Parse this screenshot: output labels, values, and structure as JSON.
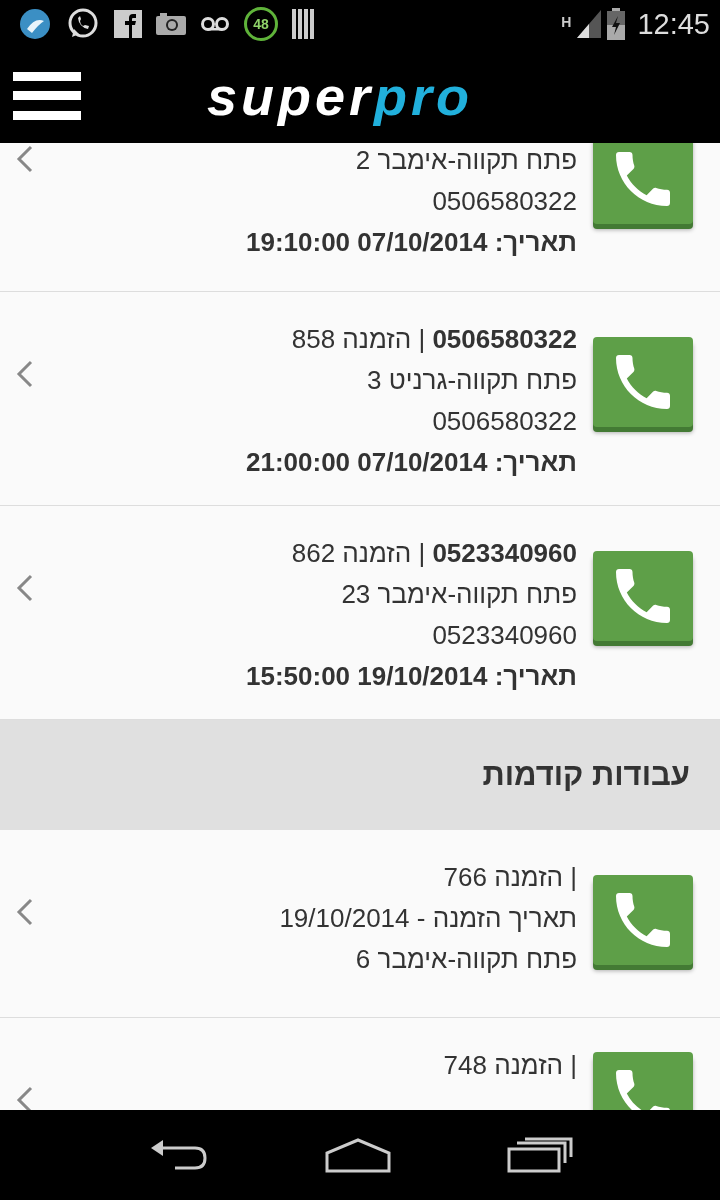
{
  "status_bar": {
    "time": "12:45",
    "network": "H",
    "badge": "48"
  },
  "header": {
    "logo_first": "super",
    "logo_second": "pro"
  },
  "list": [
    {
      "kind": "job",
      "lines": [
        {
          "text": "פתח תקווה-אימבר 2",
          "bold": false
        },
        {
          "text": "0506580322",
          "bold": false
        },
        {
          "text": "תאריך: 07/10/2014 19:10:00",
          "bold": true
        }
      ]
    },
    {
      "kind": "job",
      "lines": [
        {
          "text": "**0506580322** | הזמנה 858",
          "bold": false
        },
        {
          "text": "פתח תקווה-גרניט 3",
          "bold": false
        },
        {
          "text": "0506580322",
          "bold": false
        },
        {
          "text": "תאריך: 07/10/2014 21:00:00",
          "bold": true
        }
      ]
    },
    {
      "kind": "job",
      "lines": [
        {
          "text": "**0523340960** | הזמנה 862",
          "bold": false
        },
        {
          "text": "פתח תקווה-אימבר 23",
          "bold": false
        },
        {
          "text": "0523340960",
          "bold": false
        },
        {
          "text": "תאריך: 19/10/2014 15:50:00",
          "bold": true
        }
      ]
    },
    {
      "kind": "header",
      "title": "עבודות קודמות"
    },
    {
      "kind": "job",
      "lines": [
        {
          "text": "| הזמנה 766",
          "bold": false
        },
        {
          "text": "תאריך הזמנה - 19/10/2014",
          "bold": false
        },
        {
          "text": "פתח תקווה-אימבר 6",
          "bold": false
        }
      ]
    },
    {
      "kind": "job",
      "lines": [
        {
          "text": "| הזמנה 748",
          "bold": false
        }
      ]
    }
  ]
}
